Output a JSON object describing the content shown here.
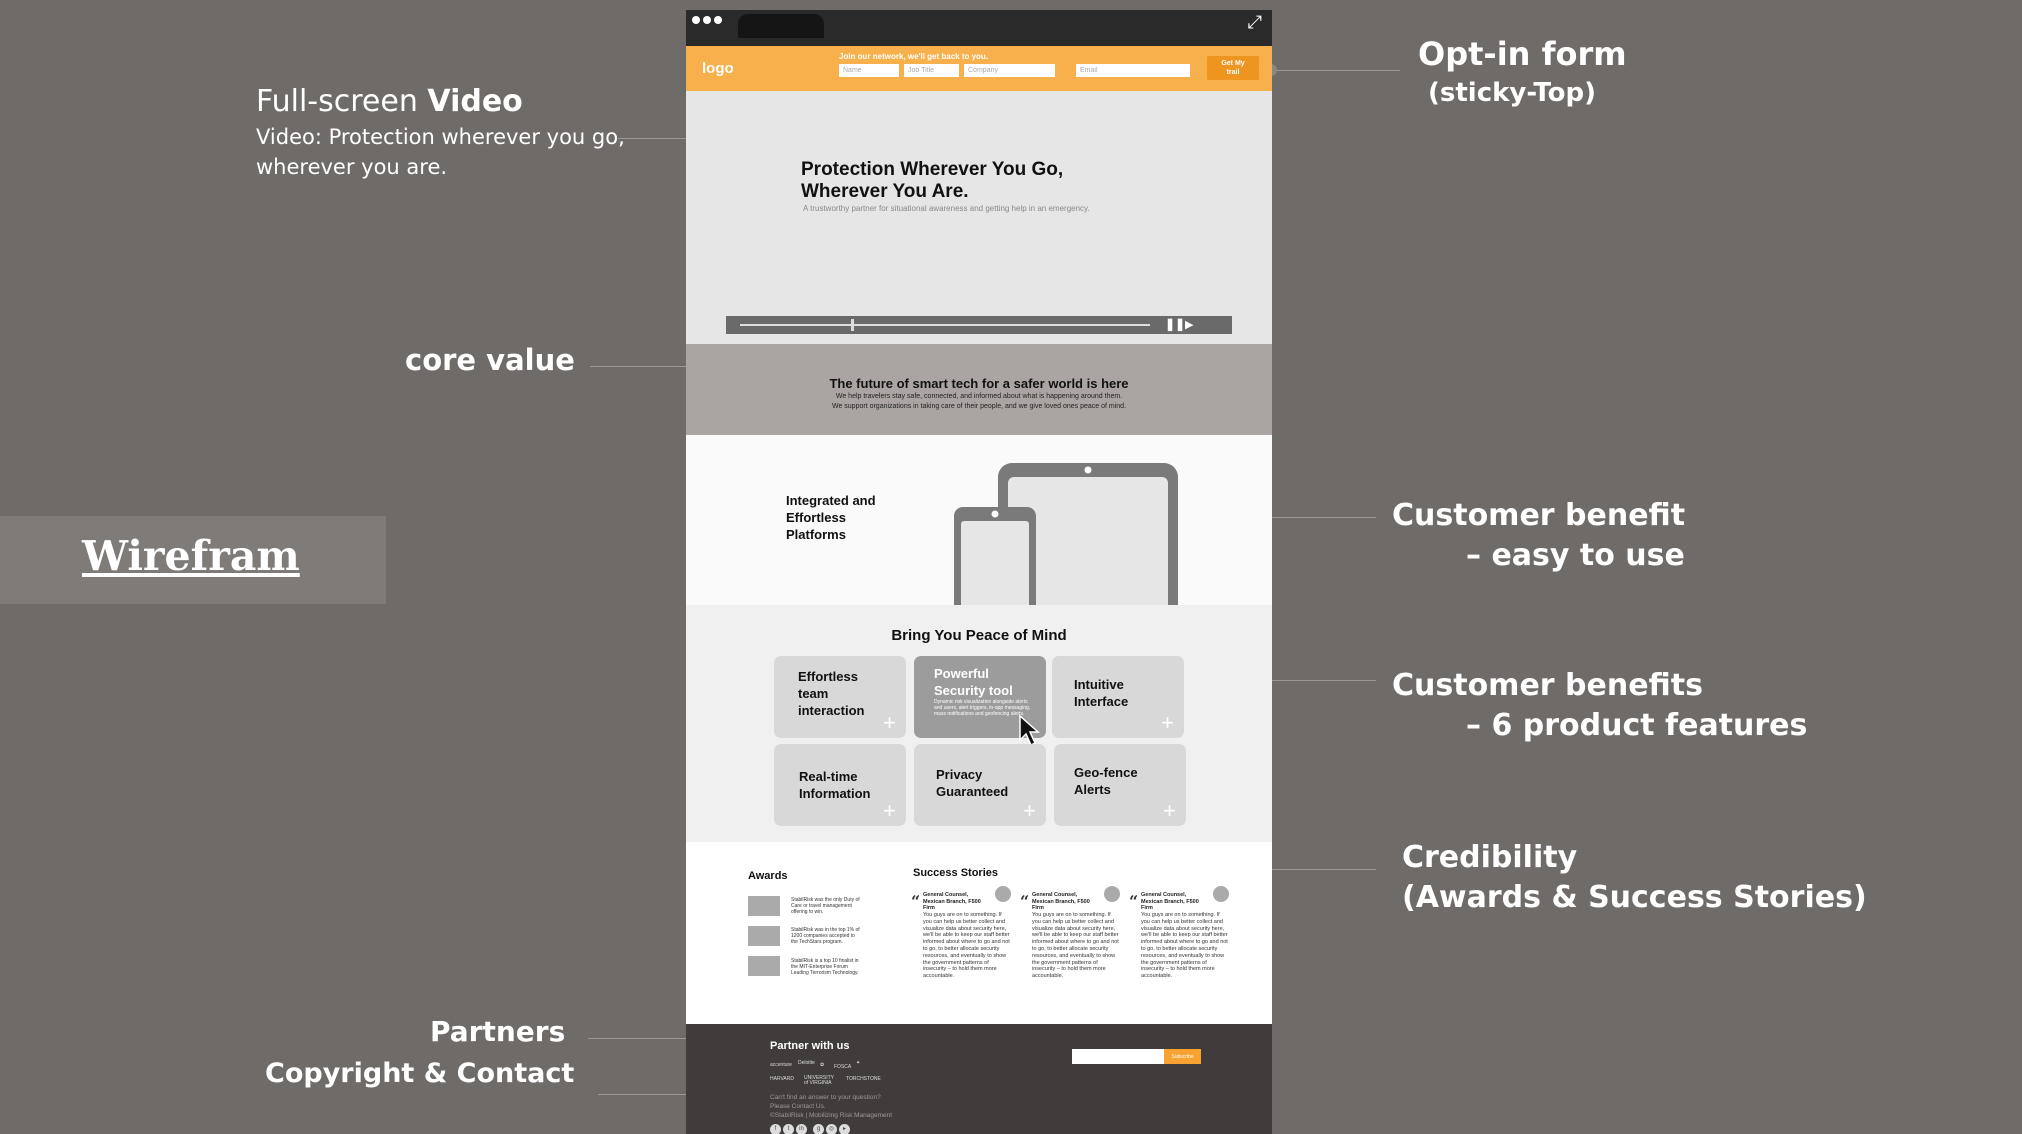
{
  "annotations": {
    "video": {
      "title_prefix": "Full-screen ",
      "title_bold": "Video",
      "line1": "Video: Protection wherever you go,",
      "line2": "wherever you are."
    },
    "core_value": "core value",
    "wireframe": "Wirefram",
    "partners": "Partners",
    "copyright": "Copyright & Contact",
    "optin": {
      "title": "Opt-in form",
      "sub": "(sticky-Top)"
    },
    "customer_benefit": {
      "line1": "Customer benefit",
      "line2": "– easy to use"
    },
    "customer_benefits": {
      "line1": "Customer benefits",
      "line2": "– 6 product features"
    },
    "credibility": {
      "line1": "Credibility",
      "line2": "(Awards & Success Stories)"
    }
  },
  "browser": {
    "icons": [
      "dots-icon",
      "expand-icon"
    ]
  },
  "optin_bar": {
    "logo": "logo",
    "heading": "Join our network, we'll get back to you.",
    "fields": [
      {
        "placeholder": "Name"
      },
      {
        "placeholder": "Job Title"
      },
      {
        "placeholder": "Company"
      },
      {
        "placeholder": "Email"
      }
    ],
    "submit_line1": "Get My",
    "submit_line2": "trail",
    "color": "#f7b04b"
  },
  "hero": {
    "title_line1": "Protection Wherever You Go,",
    "title_line2": "Wherever You Are.",
    "subtitle": "A trustworthy partner for situational awareness and getting help in an emergency.",
    "video_progress": 0.27
  },
  "core": {
    "title": "The future of smart tech for a safer world is here",
    "line1": "We help travelers stay safe, connected, and informed about what is happening around them.",
    "line2": "We support organizations in taking care of their people, and we give loved ones peace of mind."
  },
  "benefit": {
    "line1": "Integrated and",
    "line2": "Effortless",
    "line3": "Platforms"
  },
  "features": {
    "title": "Bring You Peace of Mind",
    "cards": [
      {
        "label_lines": [
          "Effortless",
          "team",
          "interaction"
        ]
      },
      {
        "label_lines": [
          "Powerful",
          "Security tool"
        ],
        "detail": "Dynamic risk visualization alongside alerts and users, alert triggers, in-app messaging, mass notifications and geofencing alerts."
      },
      {
        "label_lines": [
          "Intuitive",
          "Interface"
        ]
      },
      {
        "label_lines": [
          "Real-time",
          "Information"
        ]
      },
      {
        "label_lines": [
          "Privacy",
          "Guaranteed"
        ]
      },
      {
        "label_lines": [
          "Geo-fence",
          "Alerts"
        ]
      }
    ]
  },
  "credibility": {
    "awards_title": "Awards",
    "awards": [
      {
        "text": "StabilRisk was the only Duty of Care or travel management offering to win."
      },
      {
        "text": "StabilRisk was in the top 1% of 1200 companies accepted to the TechStars program."
      },
      {
        "text": "StabilRisk is a top 10 finalist in the MIT-Enterprise Forum Leading Terrorism Technology."
      }
    ],
    "stories_title": "Success Stories",
    "stories": [
      {
        "head": "General Counsel, Mexican Branch, F500 Firm",
        "body": "You guys are on to something. If you can help us better collect and visualize data about security here, we'll be able to keep our staff better informed about where to go and not to go, to better allocate security resources, and eventually to show the government patterns of insecurity – to hold them more accountable."
      },
      {
        "head": "General Counsel, Mexican Branch, F500 Firm",
        "body": "You guys are on to something. If you can help us better collect and visualize data about security here, we'll be able to keep our staff better informed about where to go and not to go, to better allocate security resources, and eventually to show the government patterns of insecurity – to hold them more accountable."
      },
      {
        "head": "General Counsel, Mexican Branch, F500 Firm",
        "body": "You guys are on to something. If you can help us better collect and visualize data about security here, we'll be able to keep our staff better informed about where to go and not to go, to better allocate security resources, and eventually to show the government patterns of insecurity – to hold them more accountable."
      }
    ]
  },
  "footer": {
    "partner_title": "Partner with us",
    "partners": [
      "accenture",
      "Deloitte",
      "",
      "FOSCA",
      "",
      "HARVARD",
      "UNIVERSITY of VIRGINIA",
      "TORCHSTONE"
    ],
    "subscribe_label": "Subscribe",
    "line1": "Can't find an answer to your question?",
    "line2": "Please Contact Us.",
    "line3": "©StabilRisk | Mobilizing Risk Management",
    "social": [
      "facebook-icon",
      "twitter-icon",
      "linkedin-icon",
      "google-icon",
      "instagram-icon",
      "youtube-icon"
    ]
  }
}
